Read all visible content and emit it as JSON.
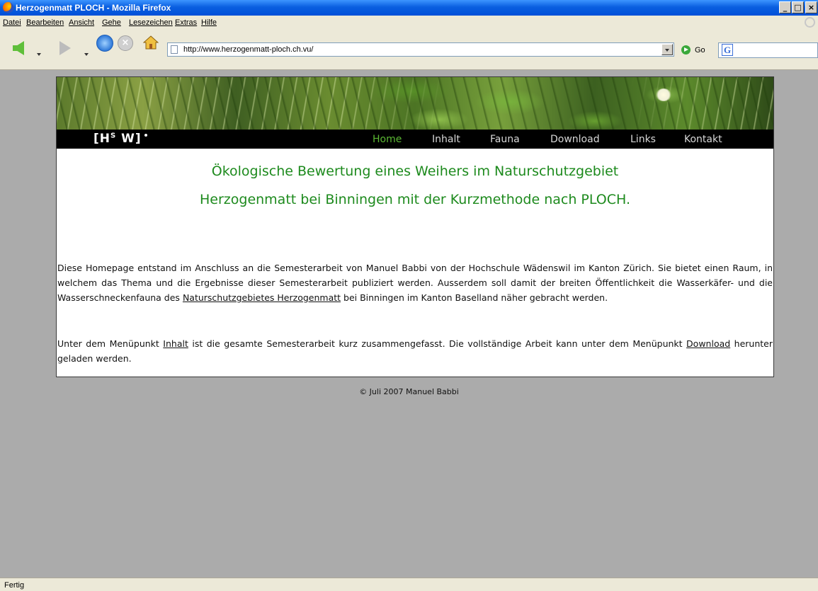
{
  "window": {
    "title": "Herzogenmatt PLOCH - Mozilla Firefox",
    "minimize_label": "_",
    "maximize_label": "□",
    "close_label": "×"
  },
  "menu": {
    "items": [
      {
        "label": "Datei"
      },
      {
        "label": "Bearbeiten"
      },
      {
        "label": "Ansicht"
      },
      {
        "label": "Gehe"
      },
      {
        "label": "Lesezeichen"
      },
      {
        "label": "Extras"
      },
      {
        "label": "Hilfe"
      }
    ]
  },
  "toolbar": {
    "url": "http://www.herzogenmatt-ploch.ch.vu/",
    "go_label": "Go",
    "search_engine_icon": "G"
  },
  "site": {
    "logo": {
      "before_sup": "[H",
      "sup": "S",
      "after_sup": " W]"
    },
    "nav": [
      {
        "label": "Home",
        "active": true
      },
      {
        "label": "Inhalt",
        "active": false
      },
      {
        "label": "Fauna",
        "active": false
      },
      {
        "label": "Download",
        "active": false
      },
      {
        "label": "Links",
        "active": false
      },
      {
        "label": "Kontakt",
        "active": false
      }
    ],
    "headline_line1": "Ökologische Bewertung eines Weihers im Naturschutzgebiet",
    "headline_line2": "Herzogenmatt bei Binningen mit der Kurzmethode nach PLOCH.",
    "paragraph1": {
      "before_link": "Diese Homepage entstand im Anschluss an die Semesterarbeit von Manuel Babbi von der Hochschule Wädenswil im Kanton Zürich. Sie bietet einen Raum, in welchem das Thema und die Ergebnisse dieser Semesterarbeit publiziert werden. Ausserdem soll damit der breiten Öffentlichkeit die Wasserkäfer- und die Wasserschneckenfauna des ",
      "link": "Naturschutzgebietes Herzogenmatt",
      "after_link": " bei Binningen im Kanton Baselland näher gebracht werden."
    },
    "paragraph2": {
      "before_link1": "Unter dem Menüpunkt ",
      "link1": "Inhalt",
      "middle": " ist die gesamte Semesterarbeit kurz zusammengefasst. Die vollständige Arbeit kann unter dem Menüpunkt ",
      "link2": "Download",
      "after_link2": " herunter geladen werden."
    },
    "footer": "© Juli 2007 Manuel Babbi",
    "colors": {
      "headline": "#1d8a1d",
      "nav_active": "#5bb833",
      "page_background": "#ababab"
    }
  },
  "status": {
    "text": "Fertig"
  }
}
